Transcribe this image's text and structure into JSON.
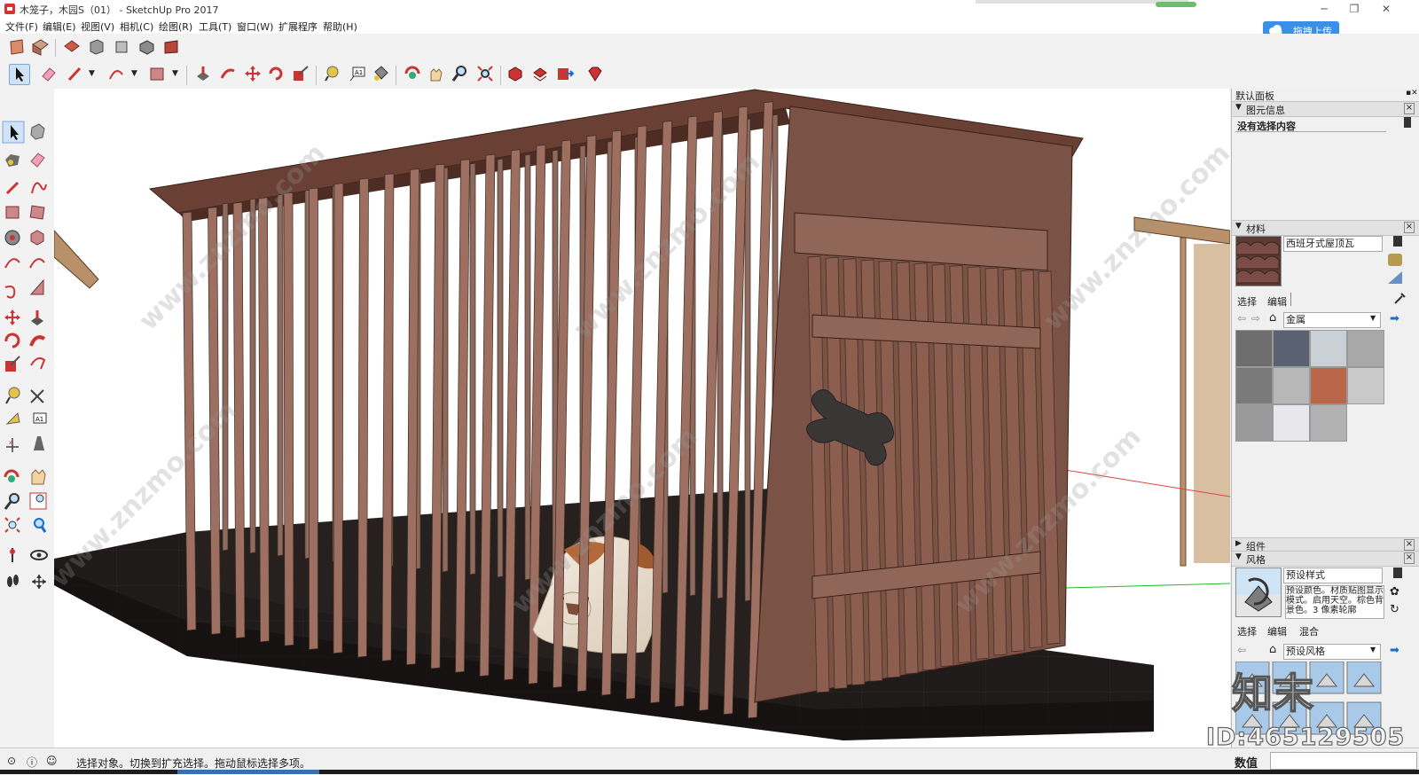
{
  "window": {
    "title": "木笼子，木园S（01） - SketchUp Pro 2017",
    "controls": [
      "─",
      "❐",
      "✕"
    ]
  },
  "menu": [
    "文件(F)",
    "编辑(E)",
    "视图(V)",
    "相机(C)",
    "绘图(R)",
    "工具(T)",
    "窗口(W)",
    "扩展程序",
    "帮助(H)"
  ],
  "upload_button": "拖拽上传",
  "tray": {
    "title": "默认面板",
    "entity_info": {
      "title": "图元信息",
      "status": "没有选择内容"
    },
    "materials": {
      "title": "材料",
      "current_name": "西班牙式屋顶瓦",
      "tabs": [
        "选择",
        "编辑"
      ],
      "library": "金属",
      "swatch_colors": [
        "#6e6e6e",
        "#5a6170",
        "#c9d0d6",
        "#a8a8a8",
        "#7a7a7a",
        "#b7b7b7",
        "#b9664a",
        "#c9c9c9",
        "#9a9a9a",
        "#e8e8ec",
        "#b2b2b2"
      ]
    },
    "components": {
      "title": "组件"
    },
    "styles": {
      "title": "风格",
      "name": "预设样式",
      "description": "预设颜色。材质贴图显示模式。启用天空。棕色背景色。3 像素轮廓",
      "tabs": [
        "选择",
        "编辑",
        "混合"
      ],
      "library": "预设风格"
    }
  },
  "status": {
    "message": "选择对象。切换到扩充选择。拖动鼠标选择多项。",
    "value_label": "数值"
  },
  "watermark": {
    "id": "ID:465129505",
    "brand": "知末",
    "site": "www.znzmo.com"
  }
}
